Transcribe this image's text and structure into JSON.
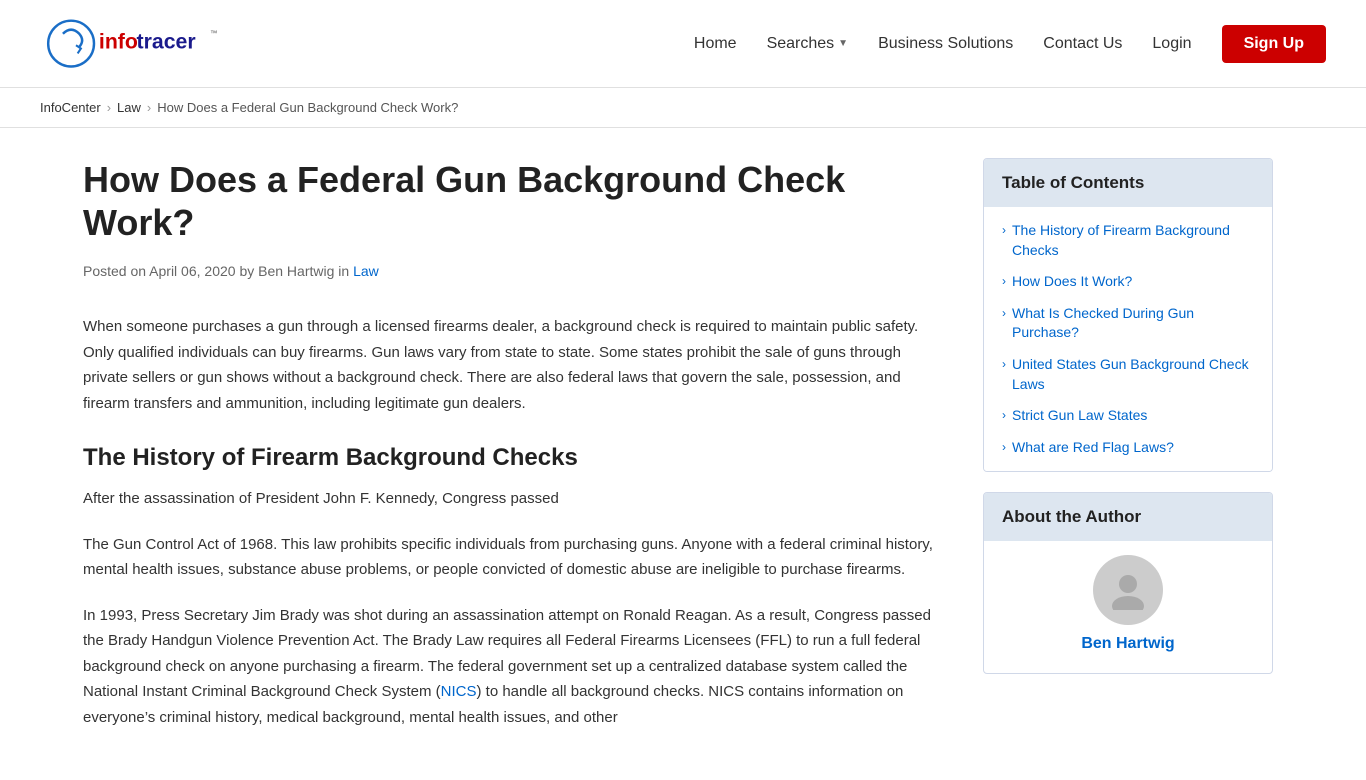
{
  "header": {
    "logo_alt": "InfoTracer",
    "nav": {
      "home": "Home",
      "searches": "Searches",
      "business_solutions": "Business Solutions",
      "contact_us": "Contact Us",
      "login": "Login",
      "signup": "Sign Up"
    }
  },
  "breadcrumb": {
    "items": [
      {
        "label": "InfoCenter",
        "href": "#"
      },
      {
        "label": "Law",
        "href": "#"
      },
      {
        "label": "How Does a Federal Gun Background Check Work?",
        "href": "#"
      }
    ]
  },
  "article": {
    "title": "How Does a Federal Gun Background Check Work?",
    "meta": "Posted on April 06, 2020 by Ben Hartwig in",
    "meta_link": "Law",
    "intro": "When someone purchases a gun through a licensed firearms dealer, a background check is required to maintain public safety. Only qualified individuals can buy firearms. Gun laws vary from state to state. Some states prohibit the sale of guns through private sellers or gun shows without a background check. There are also federal laws that govern the sale, possession, and firearm transfers and ammunition, including legitimate gun dealers.",
    "section1_title": "The History of Firearm Background Checks",
    "section1_p1": "After the assassination of President John F. Kennedy, Congress passed",
    "section1_p2": "The Gun Control Act of 1968. This law prohibits specific individuals from purchasing guns. Anyone with a federal criminal history, mental health issues, substance abuse problems, or people convicted of domestic abuse are ineligible to purchase firearms.",
    "section1_p3": "In 1993, Press Secretary Jim Brady was shot during an assassination attempt on Ronald Reagan. As a result, Congress passed the Brady Handgun Violence Prevention Act. The Brady Law requires all Federal Firearms Licensees (FFL) to run a full federal background check on anyone purchasing a firearm. The federal government set up a centralized database system called the National Instant Criminal Background Check System (",
    "nics_link": "NICS",
    "section1_p3_end": ") to handle all background checks. NICS contains information on everyone’s criminal history, medical background, mental health issues, and other"
  },
  "sidebar": {
    "toc": {
      "header": "Table of Contents",
      "items": [
        "The History of Firearm Background Checks",
        "How Does It Work?",
        "What Is Checked During Gun Purchase?",
        "United States Gun Background Check Laws",
        "Strict Gun Law States",
        "What are Red Flag Laws?"
      ]
    },
    "author": {
      "header": "About the Author",
      "name": "Ben Hartwig"
    }
  }
}
